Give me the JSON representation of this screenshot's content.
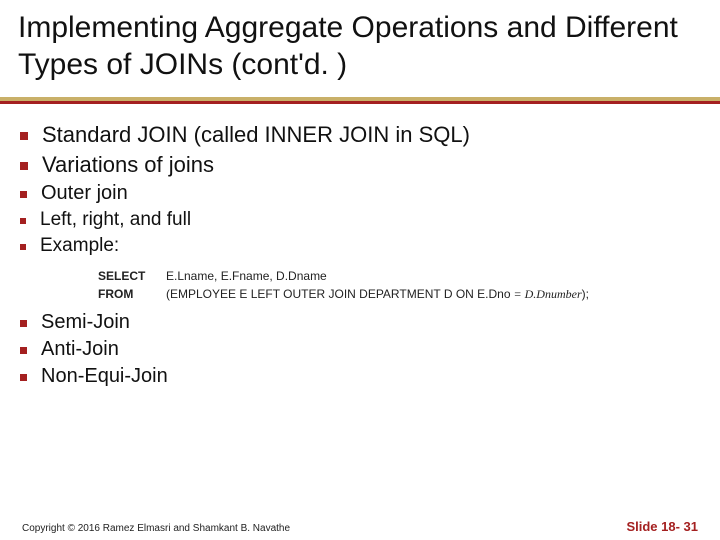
{
  "title": "Implementing Aggregate Operations and Different Types of JOINs (cont'd. )",
  "bullets": {
    "p1": "Standard JOIN (called INNER JOIN in SQL)",
    "p2": "Variations of joins",
    "p2a": "Outer join",
    "p2a1": "Left, right, and full",
    "p2a2": "Example:",
    "p2b": "Semi-Join",
    "p2c": "Anti-Join",
    "p2d": "Non-Equi-Join"
  },
  "sql": {
    "kw_select": "SELECT",
    "select_rest": "E.Lname, E.Fname, D.Dname",
    "kw_from": "FROM",
    "from_rest_a": "(EMPLOYEE E LEFT OUTER JOIN DEPARTMENT D ON E.Dno",
    "from_rest_eq": " = ",
    "from_rest_b": "D.Dnumber",
    "from_rest_c": ");"
  },
  "footer": {
    "copyright": "Copyright © 2016 Ramez Elmasri and Shamkant B. Navathe",
    "slide_label": "Slide 18- 31"
  }
}
